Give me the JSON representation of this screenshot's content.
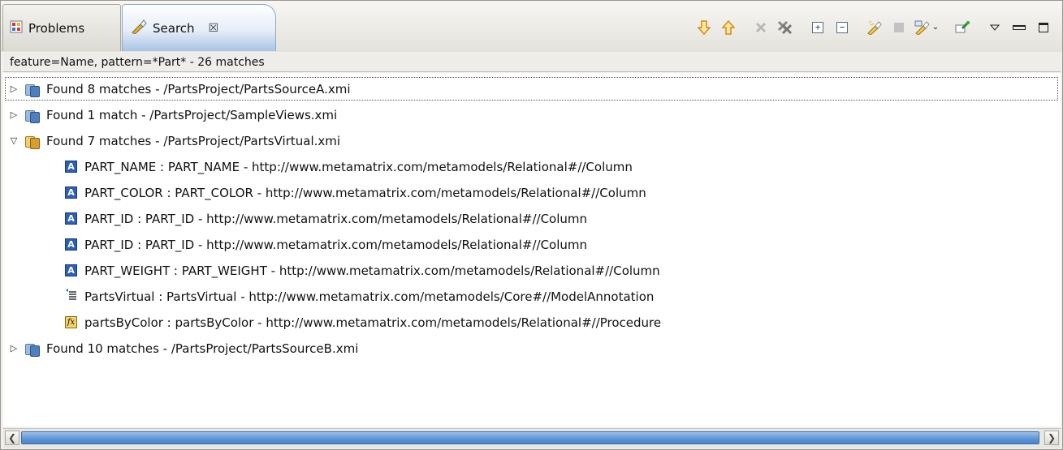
{
  "tabs": [
    {
      "label": "Problems",
      "icon": "problems-icon",
      "active": false
    },
    {
      "label": "Search",
      "icon": "search-flashlight-icon",
      "active": true,
      "close": "☒"
    }
  ],
  "toolbar": [
    {
      "name": "next-match-icon",
      "enabled": true
    },
    {
      "name": "previous-match-icon",
      "enabled": true
    },
    {
      "name": "remove-selected-icon",
      "enabled": false
    },
    {
      "name": "remove-all-icon",
      "enabled": true
    },
    {
      "name": "expand-all-icon",
      "enabled": true
    },
    {
      "name": "collapse-all-icon",
      "enabled": true
    },
    {
      "name": "run-search-icon",
      "enabled": true
    },
    {
      "name": "cancel-search-icon",
      "enabled": false
    },
    {
      "name": "search-history-icon",
      "enabled": true
    },
    {
      "name": "pin-view-icon",
      "enabled": true
    },
    {
      "name": "view-menu-icon",
      "enabled": true
    },
    {
      "name": "minimize-icon",
      "enabled": true
    },
    {
      "name": "maximize-icon",
      "enabled": true
    }
  ],
  "summary": "feature=Name, pattern=*Part* - 26 matches",
  "tree": {
    "groups": [
      {
        "label": "Found 8 matches - /PartsProject/PartsSourceA.xmi",
        "expanded": false,
        "icon": "model-blue-icon"
      },
      {
        "label": "Found 1 match - /PartsProject/SampleViews.xmi",
        "expanded": false,
        "icon": "model-blue-icon"
      },
      {
        "label": "Found 7 matches - /PartsProject/PartsVirtual.xmi",
        "expanded": true,
        "icon": "model-gold-icon",
        "children": [
          {
            "label": "PART_NAME : PART_NAME - http://www.metamatrix.com/metamodels/Relational#//Column",
            "icon": "column-icon"
          },
          {
            "label": "PART_COLOR : PART_COLOR - http://www.metamatrix.com/metamodels/Relational#//Column",
            "icon": "column-icon"
          },
          {
            "label": "PART_ID : PART_ID - http://www.metamatrix.com/metamodels/Relational#//Column",
            "icon": "column-icon"
          },
          {
            "label": "PART_ID : PART_ID - http://www.metamatrix.com/metamodels/Relational#//Column",
            "icon": "column-icon"
          },
          {
            "label": "PART_WEIGHT : PART_WEIGHT - http://www.metamatrix.com/metamodels/Relational#//Column",
            "icon": "column-icon"
          },
          {
            "label": "PartsVirtual : PartsVirtual - http://www.metamatrix.com/metamodels/Core#//ModelAnnotation",
            "icon": "annotation-icon"
          },
          {
            "label": "partsByColor : partsByColor - http://www.metamatrix.com/metamodels/Relational#//Procedure",
            "icon": "procedure-icon"
          }
        ]
      },
      {
        "label": "Found 10 matches - /PartsProject/PartsSourceB.xmi",
        "expanded": false,
        "icon": "model-blue-icon"
      }
    ]
  },
  "colors": {
    "accent": "#5c93d6",
    "tab_active_bottom": "#a9c4e6"
  }
}
